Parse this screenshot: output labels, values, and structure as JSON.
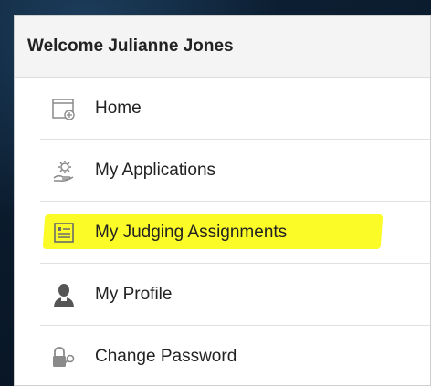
{
  "panel": {
    "title": "Welcome Julianne Jones"
  },
  "menu": {
    "items": [
      {
        "label": "Home",
        "icon": "home-page-icon"
      },
      {
        "label": "My Applications",
        "icon": "applications-icon"
      },
      {
        "label": "My Judging Assignments",
        "icon": "judging-document-icon",
        "highlighted": true
      },
      {
        "label": "My Profile",
        "icon": "profile-user-icon"
      },
      {
        "label": "Change Password",
        "icon": "key-lock-icon"
      }
    ]
  },
  "colors": {
    "highlight": "#fbfb1c",
    "icon_gray": "#9a9a9a",
    "icon_dark": "#555555"
  }
}
